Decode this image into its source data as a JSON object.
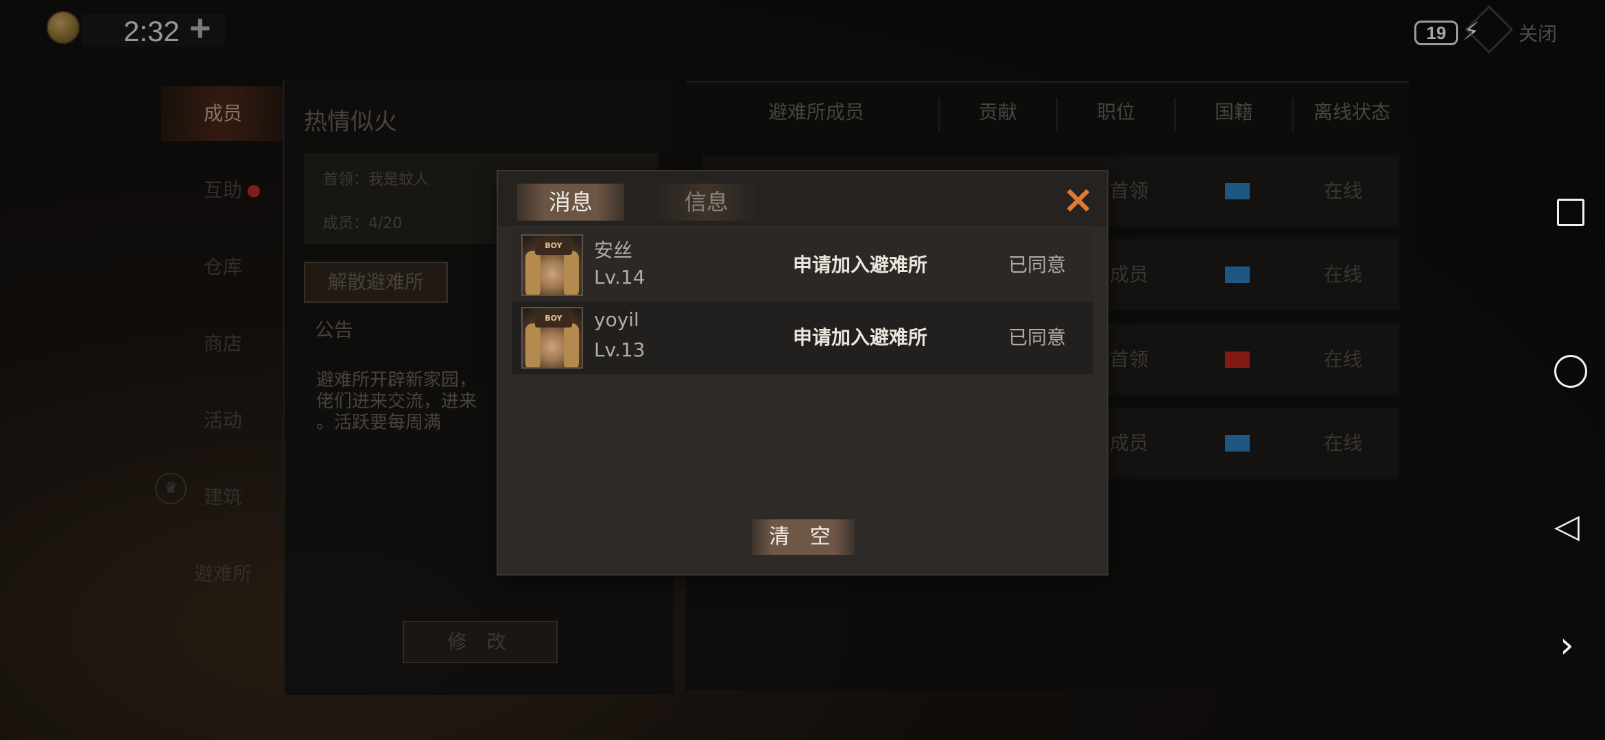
{
  "status_bar": {
    "time": "2:32",
    "add_label": "+",
    "battery": "19",
    "close_label": "关闭"
  },
  "nav": {
    "items": [
      {
        "label": "成员"
      },
      {
        "label": "互助"
      },
      {
        "label": "仓库"
      },
      {
        "label": "商店"
      },
      {
        "label": "活动"
      },
      {
        "label": "建筑"
      },
      {
        "label": "避难所"
      }
    ]
  },
  "shelter": {
    "name": "热情似火",
    "leader": "首领：我是蚊人",
    "members": "成员：4/20",
    "disband_label": "解散避难所",
    "notice_label": "公告",
    "notice_text": "避难所开辟新家园，\n佬们进来交流，进来\n。活跃要每周满",
    "modify_label": "修 改"
  },
  "member_table": {
    "headers": [
      "避难所成员",
      "贡献",
      "职位",
      "国籍",
      "离线状态"
    ],
    "rows": [
      {
        "role": "首领",
        "flag": "un",
        "status": "在线"
      },
      {
        "role": "成员",
        "flag": "un",
        "status": "在线"
      },
      {
        "role": "首领",
        "flag": "cn",
        "status": "在线"
      },
      {
        "role": "成员",
        "flag": "un",
        "status": "在线"
      }
    ]
  },
  "dialog": {
    "tabs": {
      "active": "消息",
      "inactive": "信息"
    },
    "close_icon": "×",
    "messages": [
      {
        "name": "安丝",
        "level": "Lv.14",
        "action": "申请加入避难所",
        "status": "已同意",
        "avatar_cap": "BOY"
      },
      {
        "name": "yoyil",
        "level": "Lv.13",
        "action": "申请加入避难所",
        "status": "已同意",
        "avatar_cap": "BOY"
      }
    ],
    "clear_label": "清 空"
  },
  "colors": {
    "accent": "#e07a2e",
    "alert_dot": "#c0302a",
    "un_flag": "#2f86c8",
    "cn_flag": "#c8281e"
  }
}
